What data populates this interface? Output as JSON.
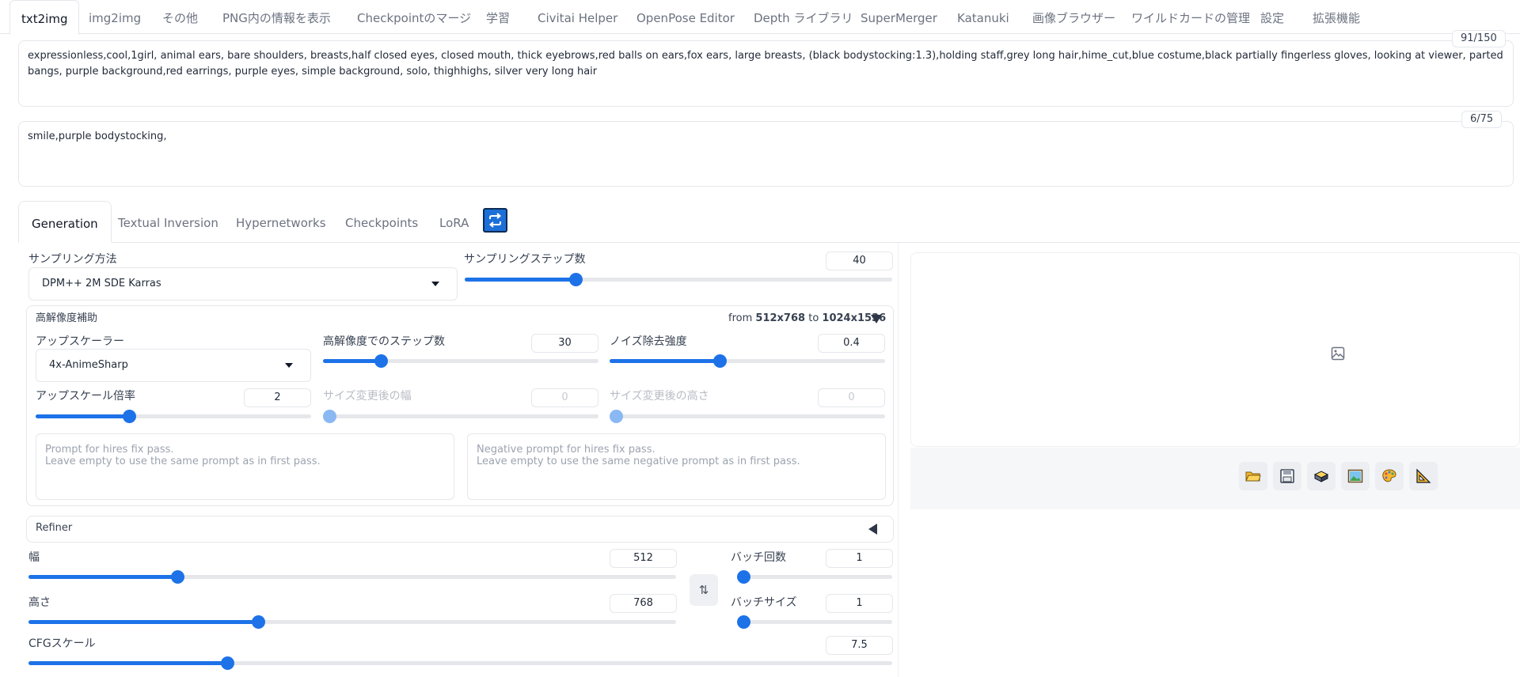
{
  "top_tabs": [
    {
      "label": "txt2img",
      "active": true
    },
    {
      "label": "img2img"
    },
    {
      "label": "その他"
    },
    {
      "label": "PNG内の情報を表示"
    },
    {
      "label": "Checkpointのマージ"
    },
    {
      "label": "学習"
    },
    {
      "label": "Civitai Helper"
    },
    {
      "label": "OpenPose Editor"
    },
    {
      "label": "Depth ライブラリ"
    },
    {
      "label": "SuperMerger"
    },
    {
      "label": "Katanuki"
    },
    {
      "label": "画像ブラウザー"
    },
    {
      "label": "ワイルドカードの管理"
    },
    {
      "label": "設定"
    },
    {
      "label": "拡張機能"
    }
  ],
  "prompt": {
    "text": "expressionless,cool,1girl, animal ears, bare shoulders, breasts,half closed eyes, closed mouth, thick eyebrows,red balls on ears,fox ears, large breasts, (black bodystocking:1.3),holding staff,grey long hair,hime_cut,blue costume,black partially fingerless gloves, looking at viewer, parted bangs, purple background,red earrings, purple eyes, simple background, solo, thighhighs, silver very long hair",
    "token_count": "91/150"
  },
  "negative_prompt": {
    "text": "smile,purple bodystocking,",
    "token_count": "6/75"
  },
  "gen_tabs": [
    {
      "label": "Generation",
      "active": true
    },
    {
      "label": "Textual Inversion"
    },
    {
      "label": "Hypernetworks"
    },
    {
      "label": "Checkpoints"
    },
    {
      "label": "LoRA"
    }
  ],
  "refresh_icon": "refresh-icon",
  "sampling": {
    "method_label": "サンプリング方法",
    "method_value": "DPM++ 2M SDE Karras",
    "steps_label": "サンプリングステップ数",
    "steps_value": "40",
    "steps_fraction": 0.26
  },
  "hires": {
    "title": "高解像度補助",
    "from_label": "from",
    "from_value": "512x768",
    "to_label": "to",
    "to_value": "1024x1536",
    "upscaler_label": "アップスケーラー",
    "upscaler_value": "4x-AnimeSharp",
    "steps_label": "高解像度でのステップ数",
    "steps_value": "30",
    "steps_fraction": 0.21,
    "denoise_label": "ノイズ除去強度",
    "denoise_value": "0.4",
    "denoise_fraction": 0.4,
    "scale_label": "アップスケール倍率",
    "scale_value": "2",
    "scale_fraction": 0.34,
    "resize_w_label": "サイズ変更後の幅",
    "resize_w_value": "0",
    "resize_h_label": "サイズ変更後の高さ",
    "resize_h_value": "0",
    "prompt_placeholder": "Prompt for hires fix pass.\nLeave empty to use the same prompt as in first pass.",
    "neg_prompt_placeholder": "Negative prompt for hires fix pass.\nLeave empty to use the same negative prompt as in first pass."
  },
  "refiner": {
    "label": "Refiner"
  },
  "size": {
    "width_label": "幅",
    "width_value": "512",
    "width_fraction": 0.23,
    "height_label": "高さ",
    "height_value": "768",
    "height_fraction": 0.355,
    "swap_icon": "swap-icon"
  },
  "batch": {
    "count_label": "バッチ回数",
    "count_value": "1",
    "size_label": "バッチサイズ",
    "size_value": "1"
  },
  "cfg": {
    "label": "CFGスケール",
    "value": "7.5",
    "fraction": 0.23
  },
  "output": {
    "placeholder_icon": "image-placeholder-icon",
    "tools": [
      "folder-icon",
      "save-icon",
      "archive-icon",
      "send-to-img2img-icon",
      "send-to-inpaint-icon",
      "send-to-extras-icon"
    ]
  }
}
